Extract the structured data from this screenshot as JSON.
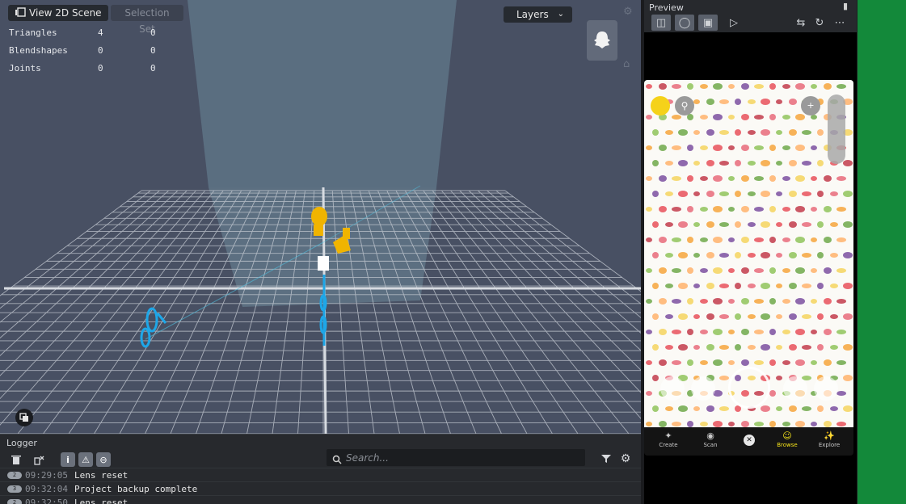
{
  "viewport": {
    "view2d_label": "View 2D Scene",
    "selection_set_label": "Selection Set",
    "layers_label": "Layers",
    "stats": [
      {
        "label": "Triangles",
        "a": "4",
        "b": "0"
      },
      {
        "label": "Blendshapes",
        "a": "0",
        "b": "0"
      },
      {
        "label": "Joints",
        "a": "0",
        "b": "0"
      }
    ]
  },
  "logger": {
    "title": "Logger",
    "search_placeholder": "Search...",
    "rows": [
      {
        "count": "2",
        "time": "09:29:05",
        "message": "Lens reset"
      },
      {
        "count": "3",
        "time": "09:32:04",
        "message": "Project backup complete"
      },
      {
        "count": "2",
        "time": "09:32:50",
        "message": "Lens reset"
      }
    ]
  },
  "preview": {
    "title": "Preview",
    "nav": [
      {
        "label": "Create",
        "icon": "wand-icon"
      },
      {
        "label": "Scan",
        "icon": "scan-icon"
      },
      {
        "label": "",
        "icon": "close-icon"
      },
      {
        "label": "Browse",
        "icon": "smile-icon"
      },
      {
        "label": "Explore",
        "icon": "explore-icon"
      }
    ]
  },
  "colors": {
    "viewport_bg": "#485063",
    "grid": "#c9ced6",
    "accent_yellow": "#f0b400",
    "accent_blue": "#1ea7e8",
    "browse_active": "#f5e31a",
    "side_green": "#13893a"
  }
}
